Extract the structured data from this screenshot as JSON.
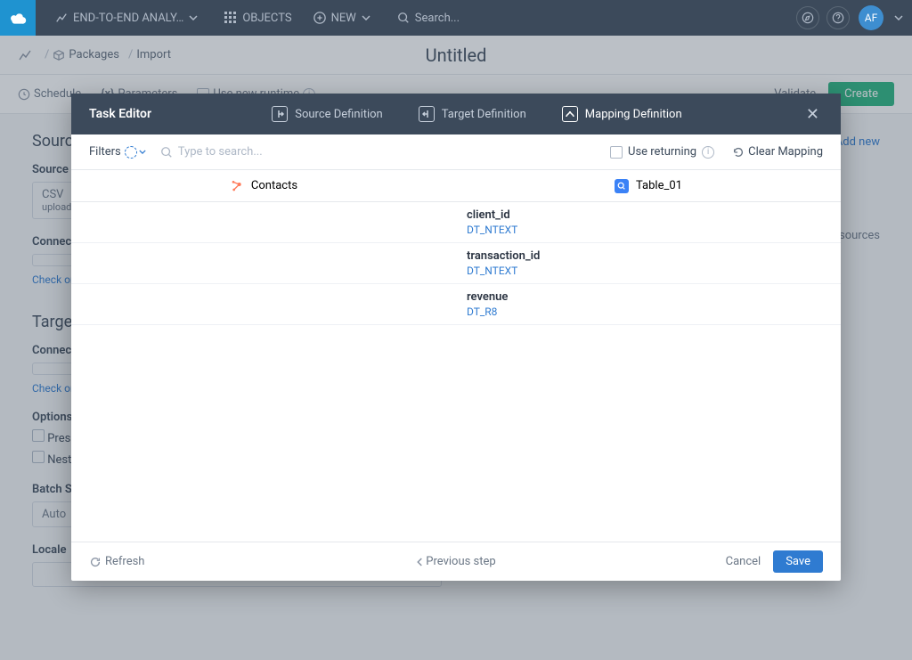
{
  "topnav": {
    "project": "END-TO-END ANALY…",
    "objects": "OBJECTS",
    "new": "NEW",
    "search_placeholder": "Search...",
    "avatar_initials": "AF"
  },
  "breadcrumbs": {
    "packages": "Packages",
    "import": "Import",
    "page_title": "Untitled"
  },
  "toolbar": {
    "schedule": "Schedule",
    "parameters": "Parameters",
    "runtime": "Use new runtime",
    "validate": "Validate",
    "create": "Create"
  },
  "background": {
    "source_heading": "Source",
    "target_heading": "Target",
    "source_type_label": "Source Type",
    "csv": "CSV",
    "upload": "upload",
    "connection_label": "Connection",
    "check_edit": "Check or edit",
    "options_label": "Options",
    "preserve": "Preserve",
    "nested": "Nested",
    "batch_size_label": "Batch Size",
    "auto": "Auto",
    "locale_label": "Locale",
    "add_new": "Add new",
    "data_sources": "sources"
  },
  "modal": {
    "title": "Task Editor",
    "tabs": {
      "source": "Source Definition",
      "target": "Target Definition",
      "mapping": "Mapping Definition"
    },
    "filters": "Filters",
    "search_placeholder": "Type to search...",
    "use_returning": "Use returning",
    "clear_mapping": "Clear Mapping",
    "left_col": "Contacts",
    "right_col": "Table_01",
    "rows": [
      {
        "field": "client_id",
        "type": "DT_NTEXT"
      },
      {
        "field": "transaction_id",
        "type": "DT_NTEXT"
      },
      {
        "field": "revenue",
        "type": "DT_R8"
      }
    ],
    "refresh": "Refresh",
    "previous": "Previous step",
    "cancel": "Cancel",
    "save": "Save"
  }
}
